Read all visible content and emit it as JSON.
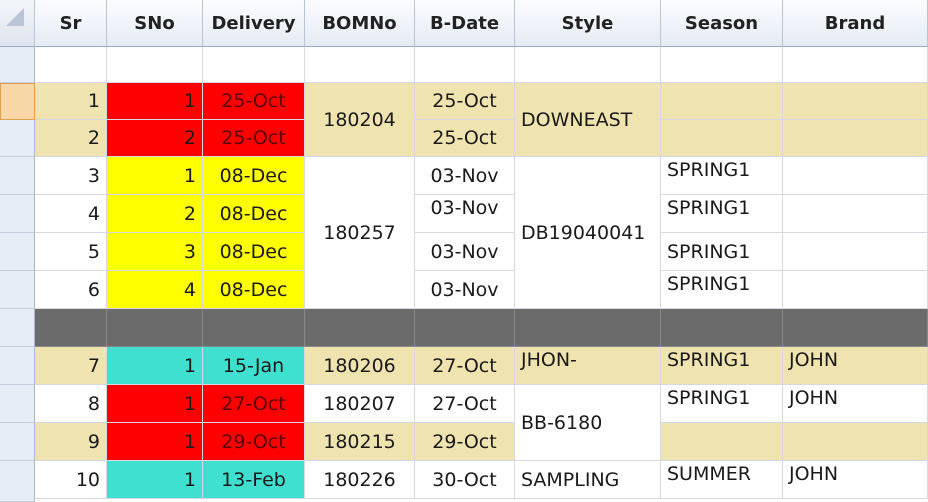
{
  "columns": [
    "Sr",
    "SNo",
    "Delivery",
    "BOMNo",
    "B-Date",
    "Style",
    "Season",
    "Brand"
  ],
  "rows": [
    {
      "sr": "1",
      "sno": "1",
      "delivery": "25-Oct",
      "bdate": "25-Oct"
    },
    {
      "sr": "2",
      "sno": "2",
      "delivery": "25-Oct",
      "bdate": "25-Oct"
    },
    {
      "sr": "3",
      "sno": "1",
      "delivery": "08-Dec",
      "bdate": "03-Nov",
      "season": "SPRING1"
    },
    {
      "sr": "4",
      "sno": "2",
      "delivery": "08-Dec",
      "bdate": "03-Nov",
      "season": "SPRING1"
    },
    {
      "sr": "5",
      "sno": "3",
      "delivery": "08-Dec",
      "bdate": "03-Nov",
      "season": "SPRING1"
    },
    {
      "sr": "6",
      "sno": "4",
      "delivery": "08-Dec",
      "bdate": "03-Nov",
      "season": "SPRING1"
    },
    {
      "sr": "7",
      "sno": "1",
      "delivery": "15-Jan",
      "bomno": "180206",
      "bdate": "27-Oct",
      "style": "JHON-",
      "season": "SPRING1",
      "brand": "JOHN"
    },
    {
      "sr": "8",
      "sno": "1",
      "delivery": "27-Oct",
      "bomno": "180207",
      "bdate": "27-Oct",
      "season": "SPRING1",
      "brand": "JOHN"
    },
    {
      "sr": "9",
      "sno": "1",
      "delivery": "29-Oct",
      "bomno": "180215",
      "bdate": "29-Oct"
    },
    {
      "sr": "10",
      "sno": "1",
      "delivery": "13-Feb",
      "bomno": "180226",
      "bdate": "30-Oct",
      "style": "SAMPLING",
      "season": "SUMMER",
      "brand": "JOHN"
    }
  ],
  "merged": {
    "bom_1_2": "180204",
    "style_1_2": "DOWNEAST",
    "bom_3_6": "180257",
    "style_3_6": "DB19040041",
    "style_8_9": "BB-6180"
  },
  "colors": {
    "red": "#ff0000",
    "yellow": "#ffff00",
    "cyan": "#40e0d0",
    "tan": "#efe4b0",
    "separator": "#6b6b6b"
  }
}
